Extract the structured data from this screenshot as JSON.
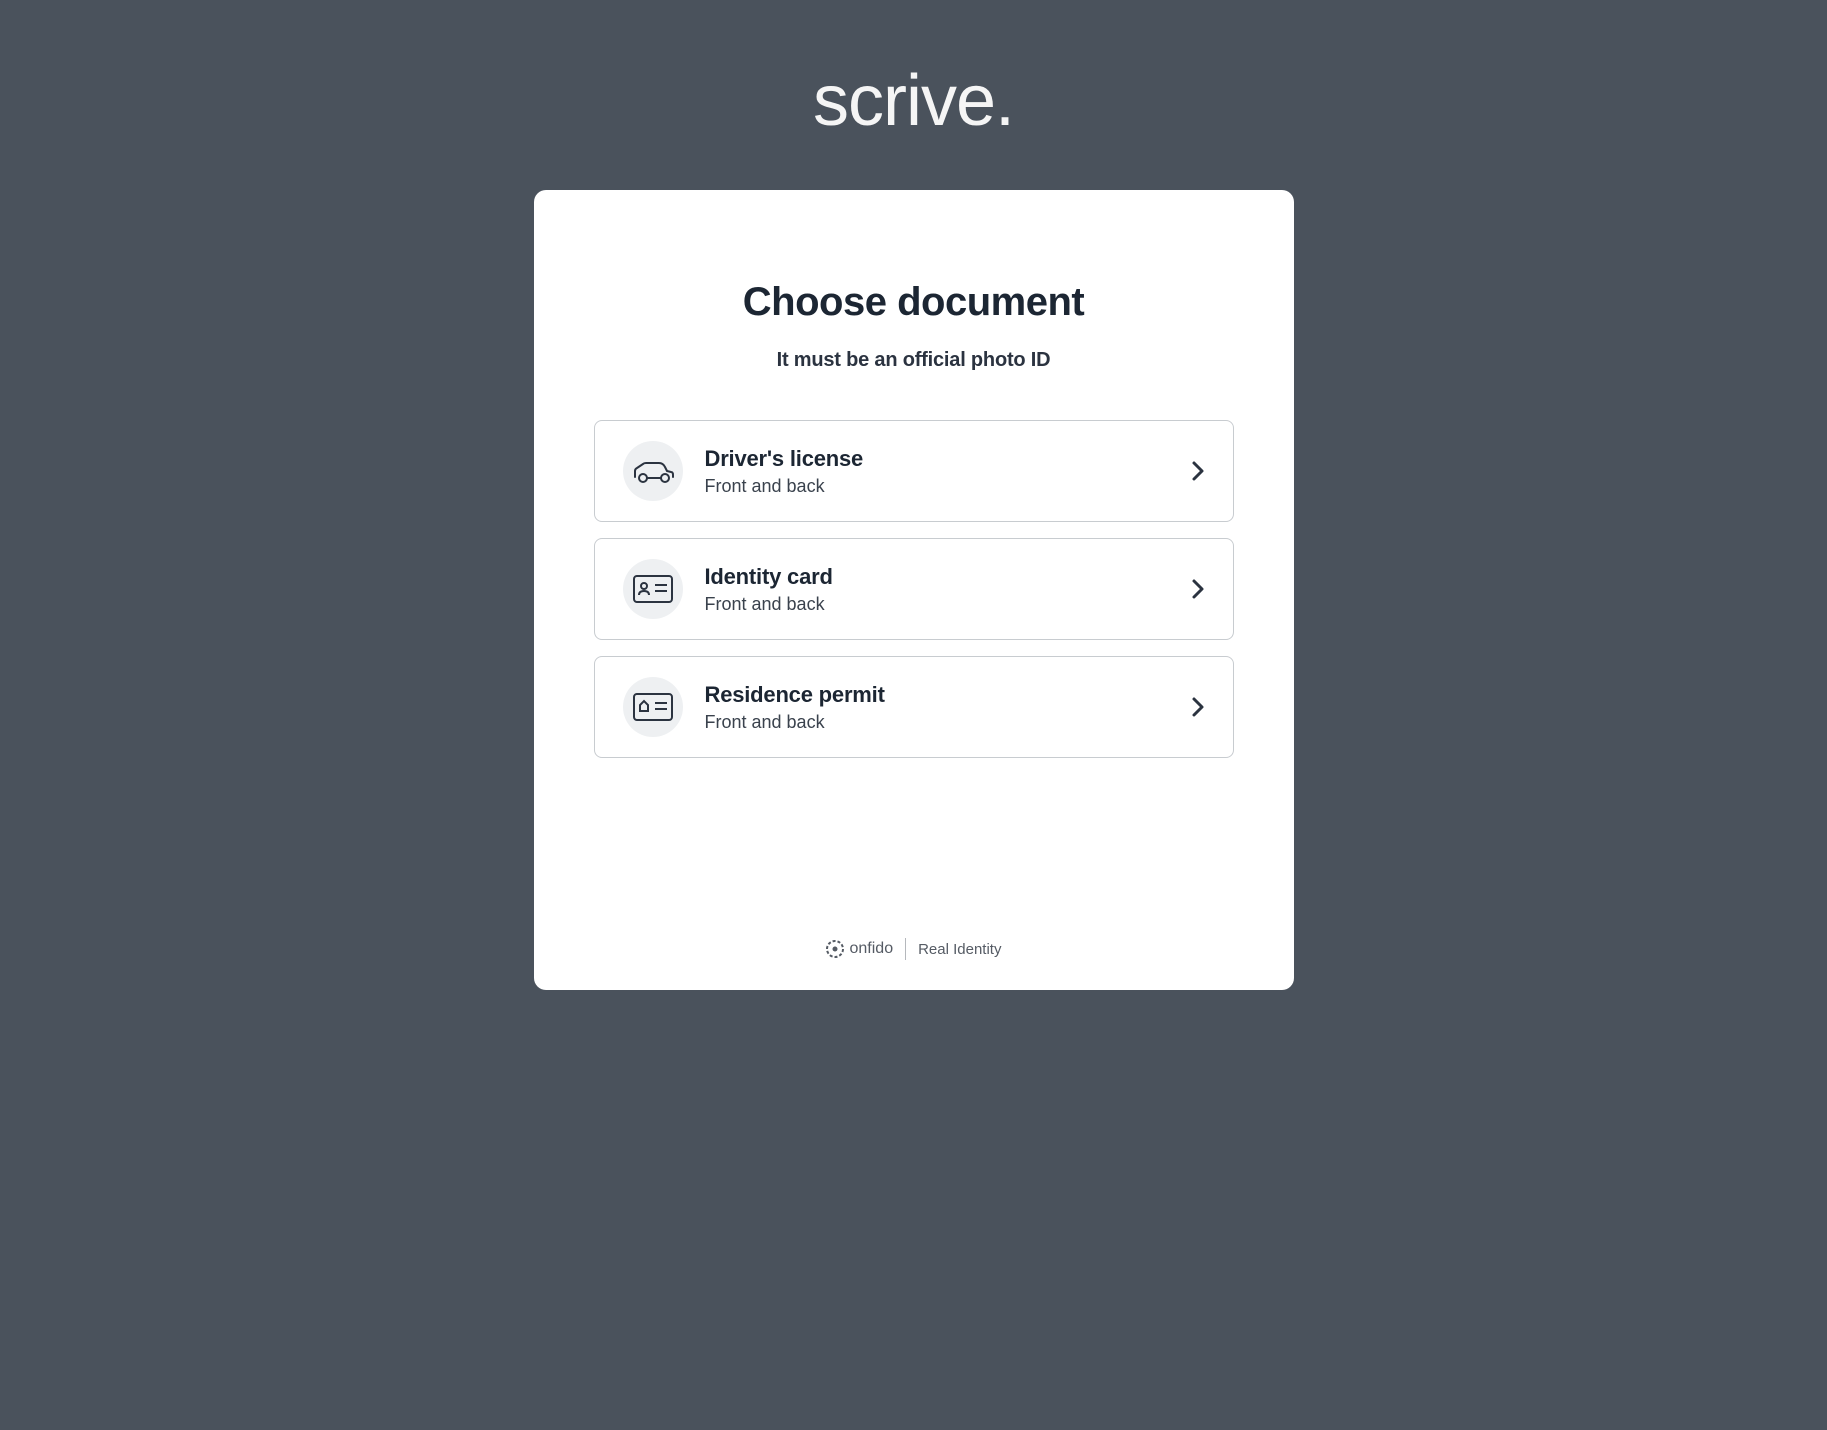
{
  "logo": "scrive.",
  "card": {
    "title": "Choose document",
    "subtitle": "It must be an official photo ID"
  },
  "options": [
    {
      "title": "Driver's license",
      "subtitle": "Front and back",
      "icon": "car-icon"
    },
    {
      "title": "Identity card",
      "subtitle": "Front and back",
      "icon": "id-card-icon"
    },
    {
      "title": "Residence permit",
      "subtitle": "Front and back",
      "icon": "permit-icon"
    }
  ],
  "footer": {
    "brand": "onfido",
    "tagline": "Real Identity"
  }
}
